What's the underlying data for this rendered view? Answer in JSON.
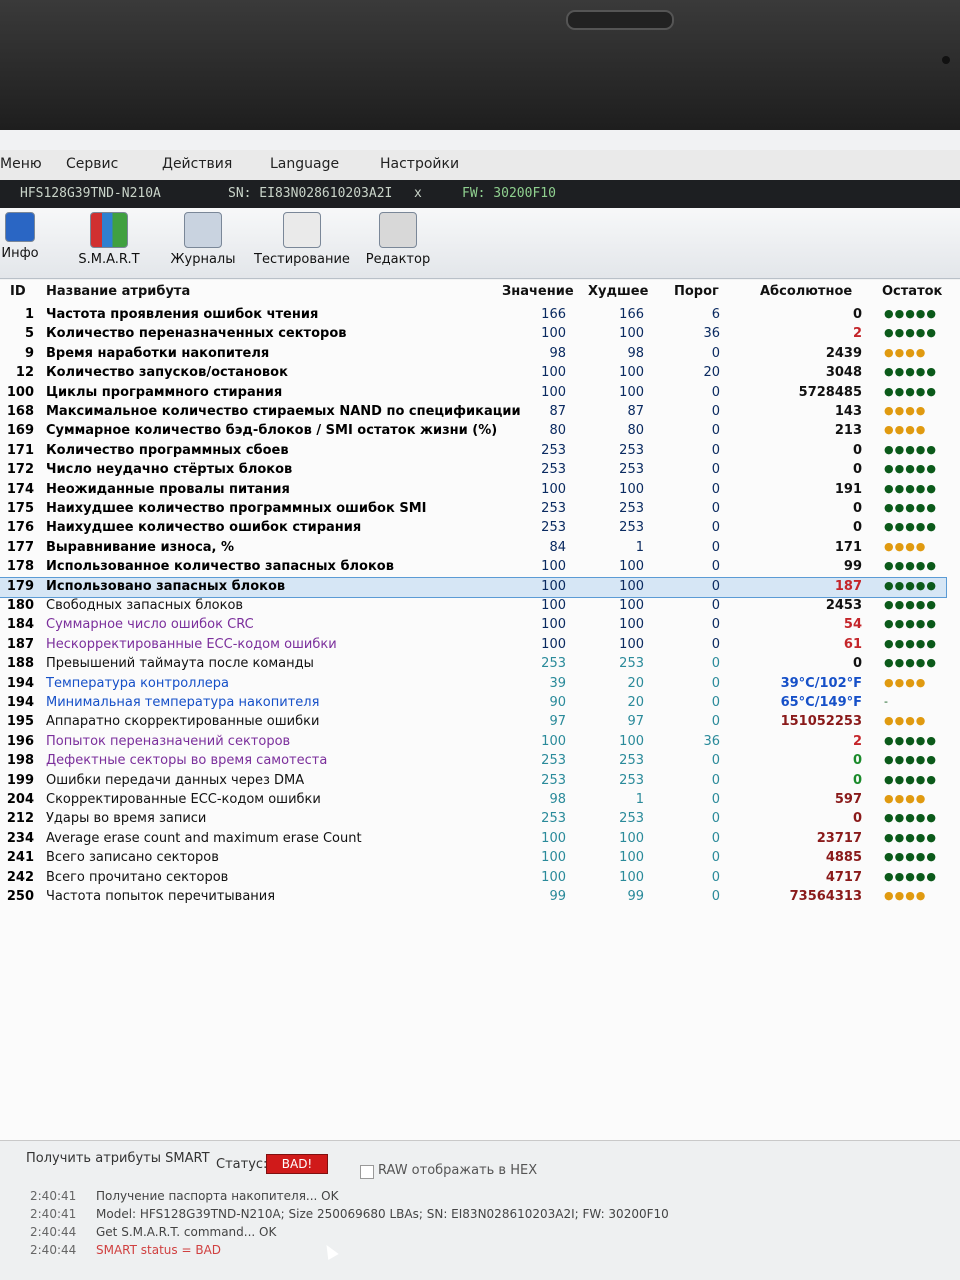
{
  "menu": [
    "Меню",
    "Сервис",
    "Действия",
    "Language",
    "Настройки"
  ],
  "device": {
    "model": "HFS128G39TND-N210A",
    "serial": "SN: EI83N028610203A2I",
    "close": "x",
    "firmware": "FW: 30200F10"
  },
  "toolbar": [
    "Инфо",
    "S.M.A.R.T",
    "Журналы",
    "Тестирование",
    "Редактор"
  ],
  "columns": [
    "ID",
    "Название атрибута",
    "Значение",
    "Худшее",
    "Порог",
    "Абсолютное",
    "Остаток"
  ],
  "rows": [
    {
      "id": "1",
      "name": "Частота проявления ошибок чтения",
      "val": "166",
      "worst": "166",
      "thr": "6",
      "abs": "0",
      "dots": "●●●●●"
    },
    {
      "id": "5",
      "name": "Количество переназначенных секторов",
      "val": "100",
      "worst": "100",
      "thr": "36",
      "abs": "2",
      "dots": "●●●●●"
    },
    {
      "id": "9",
      "name": "Время наработки накопителя",
      "val": "98",
      "worst": "98",
      "thr": "0",
      "abs": "2439",
      "dots": "●●●●"
    },
    {
      "id": "12",
      "name": "Количество запусков/остановок",
      "val": "100",
      "worst": "100",
      "thr": "20",
      "abs": "3048",
      "dots": "●●●●●"
    },
    {
      "id": "100",
      "name": "Циклы программного стирания",
      "val": "100",
      "worst": "100",
      "thr": "0",
      "abs": "5728485",
      "dots": "●●●●●"
    },
    {
      "id": "168",
      "name": "Максимальное количество стираемых NAND по спецификации",
      "val": "87",
      "worst": "87",
      "thr": "0",
      "abs": "143",
      "dots": "●●●●"
    },
    {
      "id": "169",
      "name": "Суммарное количество бэд-блоков / SMI остаток жизни (%)",
      "val": "80",
      "worst": "80",
      "thr": "0",
      "abs": "213",
      "dots": "●●●●"
    },
    {
      "id": "171",
      "name": "Количество программных сбоев",
      "val": "253",
      "worst": "253",
      "thr": "0",
      "abs": "0",
      "dots": "●●●●●"
    },
    {
      "id": "172",
      "name": "Число неудачно стёртых блоков",
      "val": "253",
      "worst": "253",
      "thr": "0",
      "abs": "0",
      "dots": "●●●●●"
    },
    {
      "id": "174",
      "name": "Неожиданные провалы питания",
      "val": "100",
      "worst": "100",
      "thr": "0",
      "abs": "191",
      "dots": "●●●●●"
    },
    {
      "id": "175",
      "name": "Наихудшее количество программных ошибок SMI",
      "val": "253",
      "worst": "253",
      "thr": "0",
      "abs": "0",
      "dots": "●●●●●"
    },
    {
      "id": "176",
      "name": "Наихудшее количество ошибок стирания",
      "val": "253",
      "worst": "253",
      "thr": "0",
      "abs": "0",
      "dots": "●●●●●"
    },
    {
      "id": "177",
      "name": "Выравнивание износа, %",
      "val": "84",
      "worst": "1",
      "thr": "0",
      "abs": "171",
      "dots": "●●●●"
    },
    {
      "id": "178",
      "name": "Использованное количество запасных блоков",
      "val": "100",
      "worst": "100",
      "thr": "0",
      "abs": "99",
      "dots": "●●●●●"
    },
    {
      "id": "179",
      "name": "Использовано запасных блоков",
      "val": "100",
      "worst": "100",
      "thr": "0",
      "abs": "187",
      "dots": "●●●●●"
    },
    {
      "id": "180",
      "name": "Свободных запасных блоков",
      "val": "100",
      "worst": "100",
      "thr": "0",
      "abs": "2453",
      "dots": "●●●●●"
    },
    {
      "id": "184",
      "name": "Суммарное число ошибок CRC",
      "val": "100",
      "worst": "100",
      "thr": "0",
      "abs": "54",
      "dots": "●●●●●"
    },
    {
      "id": "187",
      "name": "Нескорректированные ECC-кодом ошибки",
      "val": "100",
      "worst": "100",
      "thr": "0",
      "abs": "61",
      "dots": "●●●●●"
    },
    {
      "id": "188",
      "name": "Превышений таймаута после команды",
      "val": "253",
      "worst": "253",
      "thr": "0",
      "abs": "0",
      "dots": "●●●●●"
    },
    {
      "id": "194",
      "name": "Температура контроллера",
      "val": "39",
      "worst": "20",
      "thr": "0",
      "abs": "39°C/102°F",
      "dots": "●●●●"
    },
    {
      "id": "194",
      "name": "Минимальная температура накопителя",
      "val": "90",
      "worst": "20",
      "thr": "0",
      "abs": "65°C/149°F",
      "dots": "-"
    },
    {
      "id": "195",
      "name": "Аппаратно скорректированные ошибки",
      "val": "97",
      "worst": "97",
      "thr": "0",
      "abs": "151052253",
      "dots": "●●●●"
    },
    {
      "id": "196",
      "name": "Попыток переназначений секторов",
      "val": "100",
      "worst": "100",
      "thr": "36",
      "abs": "2",
      "dots": "●●●●●"
    },
    {
      "id": "198",
      "name": "Дефектные секторы во время самотеста",
      "val": "253",
      "worst": "253",
      "thr": "0",
      "abs": "0",
      "dots": "●●●●●"
    },
    {
      "id": "199",
      "name": "Ошибки передачи данных через DMA",
      "val": "253",
      "worst": "253",
      "thr": "0",
      "abs": "0",
      "dots": "●●●●●"
    },
    {
      "id": "204",
      "name": "Скорректированные ECC-кодом ошибки",
      "val": "98",
      "worst": "1",
      "thr": "0",
      "abs": "597",
      "dots": "●●●●"
    },
    {
      "id": "212",
      "name": "Удары во время записи",
      "val": "253",
      "worst": "253",
      "thr": "0",
      "abs": "0",
      "dots": "●●●●●"
    },
    {
      "id": "234",
      "name": "Average erase count and maximum erase Count",
      "val": "100",
      "worst": "100",
      "thr": "0",
      "abs": "23717",
      "dots": "●●●●●"
    },
    {
      "id": "241",
      "name": "Всего записано секторов",
      "val": "100",
      "worst": "100",
      "thr": "0",
      "abs": "4885",
      "dots": "●●●●●"
    },
    {
      "id": "242",
      "name": "Всего прочитано секторов",
      "val": "100",
      "worst": "100",
      "thr": "0",
      "abs": "4717",
      "dots": "●●●●●"
    },
    {
      "id": "250",
      "name": "Частота попыток перечитывания",
      "val": "99",
      "worst": "99",
      "thr": "0",
      "abs": "73564313",
      "dots": "●●●●"
    }
  ],
  "bottom": {
    "get_button": "Получить атрибуты SMART",
    "status_label": "Статус:",
    "status_value": "BAD!",
    "raw_label": "RAW отображать в HEX"
  },
  "log": [
    {
      "time": "2:40:41",
      "msg": "Получение паспорта накопителя... OK"
    },
    {
      "time": "2:40:41",
      "msg": "Model: HFS128G39TND-N210A; Size 250069680 LBAs; SN: EI83N028610203A2I; FW: 30200F10"
    },
    {
      "time": "2:40:44",
      "msg": "Get S.M.A.R.T. command... OK"
    },
    {
      "time": "2:40:44",
      "msg": "SMART status = BAD"
    }
  ],
  "colors": {
    "status_bad": "#d01a1a",
    "dots_good": "#0b5a1a",
    "dots_warn": "#e09a10",
    "selection": "#d6e6f5"
  }
}
